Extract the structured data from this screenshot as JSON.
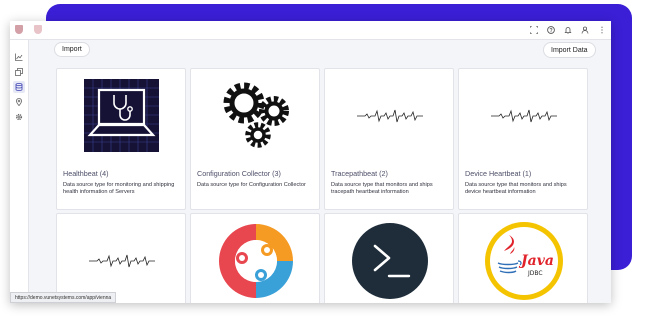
{
  "header": {
    "icons": [
      "fullscreen-icon",
      "help-icon",
      "bell-icon",
      "user-icon",
      "more-icon"
    ]
  },
  "sidebar": {
    "icons": [
      "chart-icon",
      "copy-icon",
      "database-icon",
      "location-icon",
      "gear-icon"
    ],
    "active_index": 2
  },
  "toolbar": {
    "import_label": "Import",
    "import_data_label": "Import Data"
  },
  "cards": [
    {
      "title": "Healthbeat (4)",
      "description": "Data source type for monitoring and shipping health information of Servers",
      "image": "laptop-stethoscope"
    },
    {
      "title": "Configuration Collector (3)",
      "description": "Data source type for Configuration Collector",
      "image": "gears"
    },
    {
      "title": "Tracepathbeat (2)",
      "description": "Data source type that monitors and ships tracepath heartbeat information",
      "image": "heartbeat-line"
    },
    {
      "title": "Device Heartbeat (1)",
      "description": "Data source type that monitors and ships device heartbeat information",
      "image": "heartbeat-line"
    },
    {
      "title": "",
      "description": "",
      "image": "heartbeat-line"
    },
    {
      "title": "",
      "description": "",
      "image": "people-circle-logo"
    },
    {
      "title": "",
      "description": "",
      "image": "terminal-prompt"
    },
    {
      "title": "",
      "description": "",
      "image": "java-jdbc-logo"
    }
  ],
  "java_logo": {
    "text": "Java",
    "sub": "JDBC"
  },
  "status_bar": {
    "url": "https://demo.vunetsystems.com/app/vienna"
  },
  "colors": {
    "accent": "#3a1fd6",
    "link": "#4d4f68"
  }
}
